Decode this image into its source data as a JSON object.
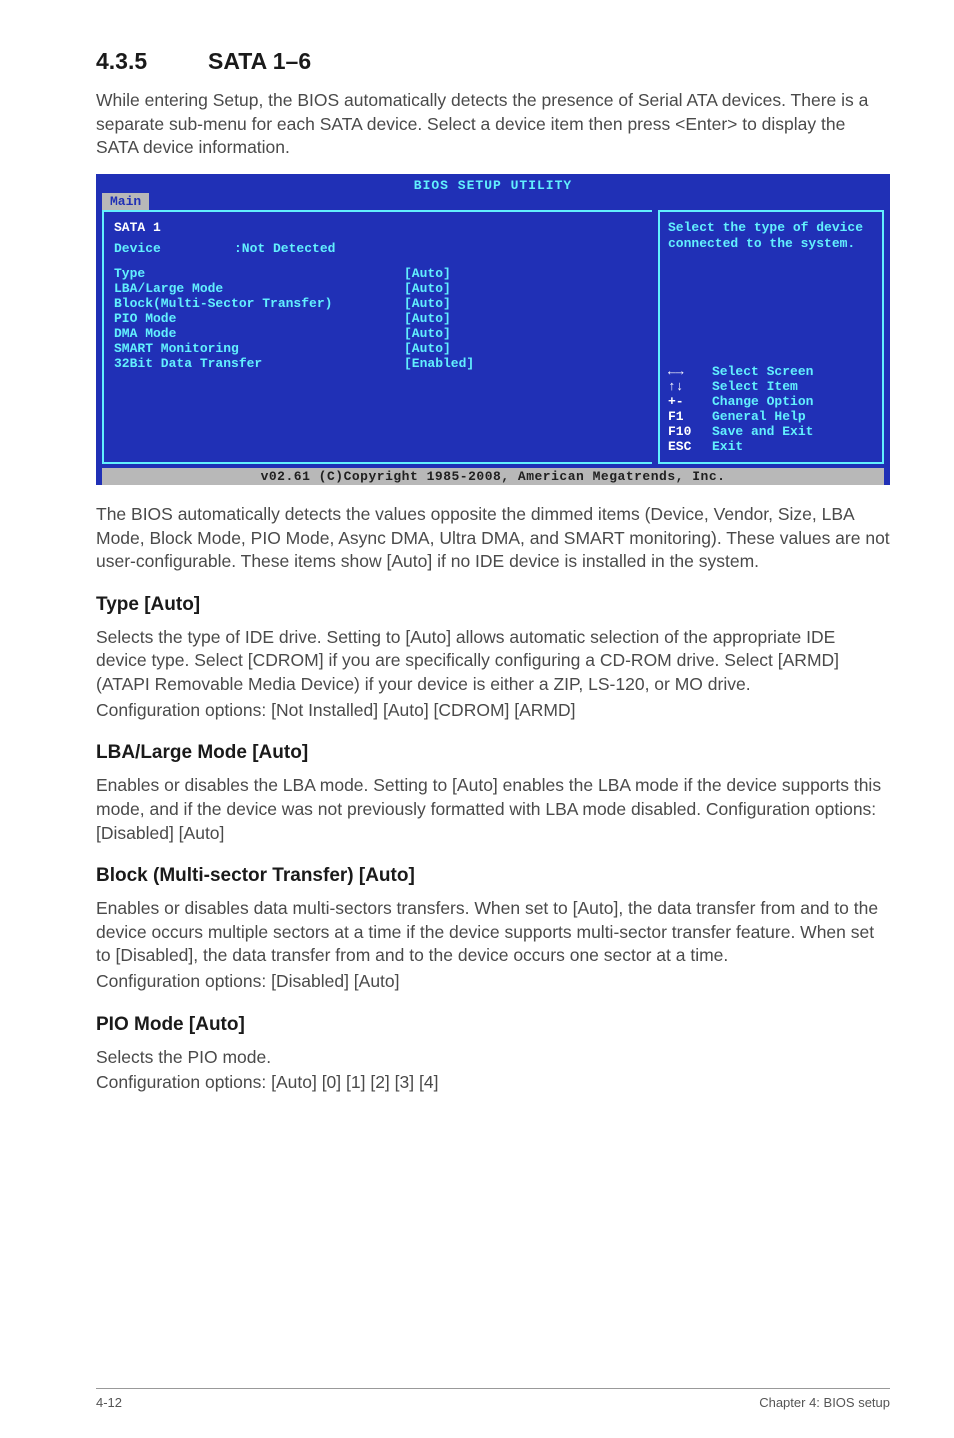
{
  "section": {
    "number": "4.3.5",
    "title": "SATA 1–6"
  },
  "intro": "While entering Setup, the BIOS automatically detects the presence of Serial ATA devices. There is a separate sub-menu for each SATA device. Select a device item then press <Enter> to display the SATA device information.",
  "bios": {
    "title": "BIOS SETUP UTILITY",
    "tab": "Main",
    "header": "SATA 1",
    "device_label": "Device",
    "device_value": ":Not Detected",
    "items": [
      {
        "label": "Type",
        "value": "[Auto]"
      },
      {
        "label": "LBA/Large Mode",
        "value": "[Auto]"
      },
      {
        "label": "Block(Multi-Sector Transfer)",
        "value": "[Auto]"
      },
      {
        "label": "PIO Mode",
        "value": "[Auto]"
      },
      {
        "label": "DMA Mode",
        "value": "[Auto]"
      },
      {
        "label": "SMART Monitoring",
        "value": "[Auto]"
      },
      {
        "label": "32Bit Data Transfer",
        "value": "[Enabled]"
      }
    ],
    "help": "Select the type of device connected to the system.",
    "hints": [
      {
        "key": "←→",
        "text": "Select Screen"
      },
      {
        "key": "↑↓",
        "text": "Select Item"
      },
      {
        "key": "+-",
        "text": "Change Option"
      },
      {
        "key": "F1",
        "text": "General Help"
      },
      {
        "key": "F10",
        "text": "Save and Exit"
      },
      {
        "key": "ESC",
        "text": "Exit"
      }
    ],
    "copyright": "v02.61 (C)Copyright 1985-2008, American Megatrends, Inc."
  },
  "after_bios": "The BIOS automatically detects the values opposite the dimmed items (Device, Vendor, Size, LBA Mode, Block Mode, PIO Mode, Async DMA, Ultra DMA, and SMART monitoring). These values are not user-configurable. These items show [Auto] if no IDE device is installed in the system.",
  "type": {
    "heading": "Type [Auto]",
    "p1": "Selects the type of IDE drive. Setting to [Auto] allows automatic selection of the appropriate IDE device type. Select [CDROM] if you are specifically configuring a CD-ROM drive. Select [ARMD] (ATAPI Removable Media Device) if your device is either a ZIP, LS-120, or MO drive.",
    "p2": "Configuration options: [Not Installed] [Auto] [CDROM] [ARMD]"
  },
  "lba": {
    "heading": "LBA/Large Mode [Auto]",
    "p": "Enables or disables the LBA mode. Setting to [Auto] enables the LBA mode if the device supports this mode, and if the device was not previously formatted with LBA mode disabled. Configuration options: [Disabled] [Auto]"
  },
  "block": {
    "heading": "Block (Multi-sector Transfer) [Auto]",
    "p1": "Enables or disables data multi-sectors transfers. When set to [Auto], the data transfer from and to the device occurs multiple sectors at a time if the device supports multi-sector transfer feature. When set to [Disabled], the data transfer from and to the device occurs one sector at a time.",
    "p2": "Configuration options: [Disabled] [Auto]"
  },
  "pio": {
    "heading": "PIO Mode [Auto]",
    "p1": "Selects the PIO mode.",
    "p2": "Configuration options: [Auto] [0] [1] [2] [3] [4]"
  },
  "footer": {
    "left": "4-12",
    "right": "Chapter 4: BIOS setup"
  }
}
